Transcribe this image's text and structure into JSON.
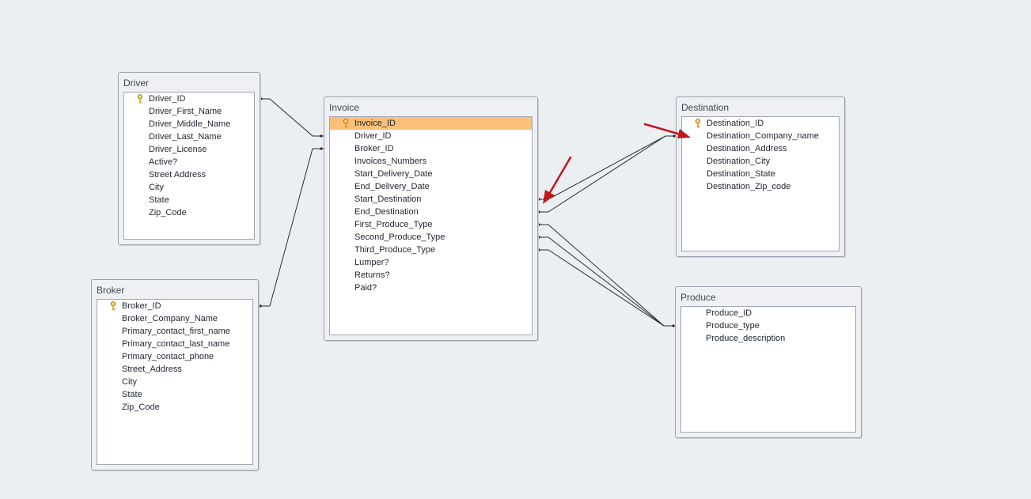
{
  "tables": {
    "driver": {
      "title": "Driver",
      "key_icon": "key-icon",
      "fields": [
        "Driver_ID",
        "Driver_First_Name",
        "Driver_Middle_Name",
        "Driver_Last_Name",
        "Driver_License",
        "Active?",
        "Street Address",
        "City",
        "State",
        "Zip_Code"
      ]
    },
    "broker": {
      "title": "Broker",
      "key_icon": "key-icon",
      "fields": [
        "Broker_ID",
        "Broker_Company_Name",
        "Primary_contact_first_name",
        "Primary_contact_last_name",
        "Primary_contact_phone",
        "Street_Address",
        "City",
        "State",
        "Zip_Code"
      ]
    },
    "invoice": {
      "title": "Invoice",
      "key_icon": "key-icon",
      "selected_field": "Invoice_ID",
      "fields": [
        "Invoice_ID",
        "Driver_ID",
        "Broker_ID",
        "Invoices_Numbers",
        "Start_Delivery_Date",
        "End_Delivery_Date",
        "Start_Destination",
        "End_Destination",
        "First_Produce_Type",
        "Second_Produce_Type",
        "Third_Produce_Type",
        "Lumper?",
        "Returns?",
        "Paid?"
      ]
    },
    "destination": {
      "title": "Destination",
      "key_icon": "key-icon",
      "fields": [
        "Destination_ID",
        "Destination_Company_name",
        "Destination_Address",
        "Destination_City",
        "Destination_State",
        "Destination_Zip_code"
      ]
    },
    "produce": {
      "title": "Produce",
      "fields": [
        "Produce_ID",
        "Produce_type",
        "Produce_description"
      ]
    }
  },
  "colors": {
    "background": "#eceff2",
    "selected_row": "#fbbf7a",
    "relationship_line": "#2b2b2b",
    "annotation_arrow": "#c0171c"
  }
}
